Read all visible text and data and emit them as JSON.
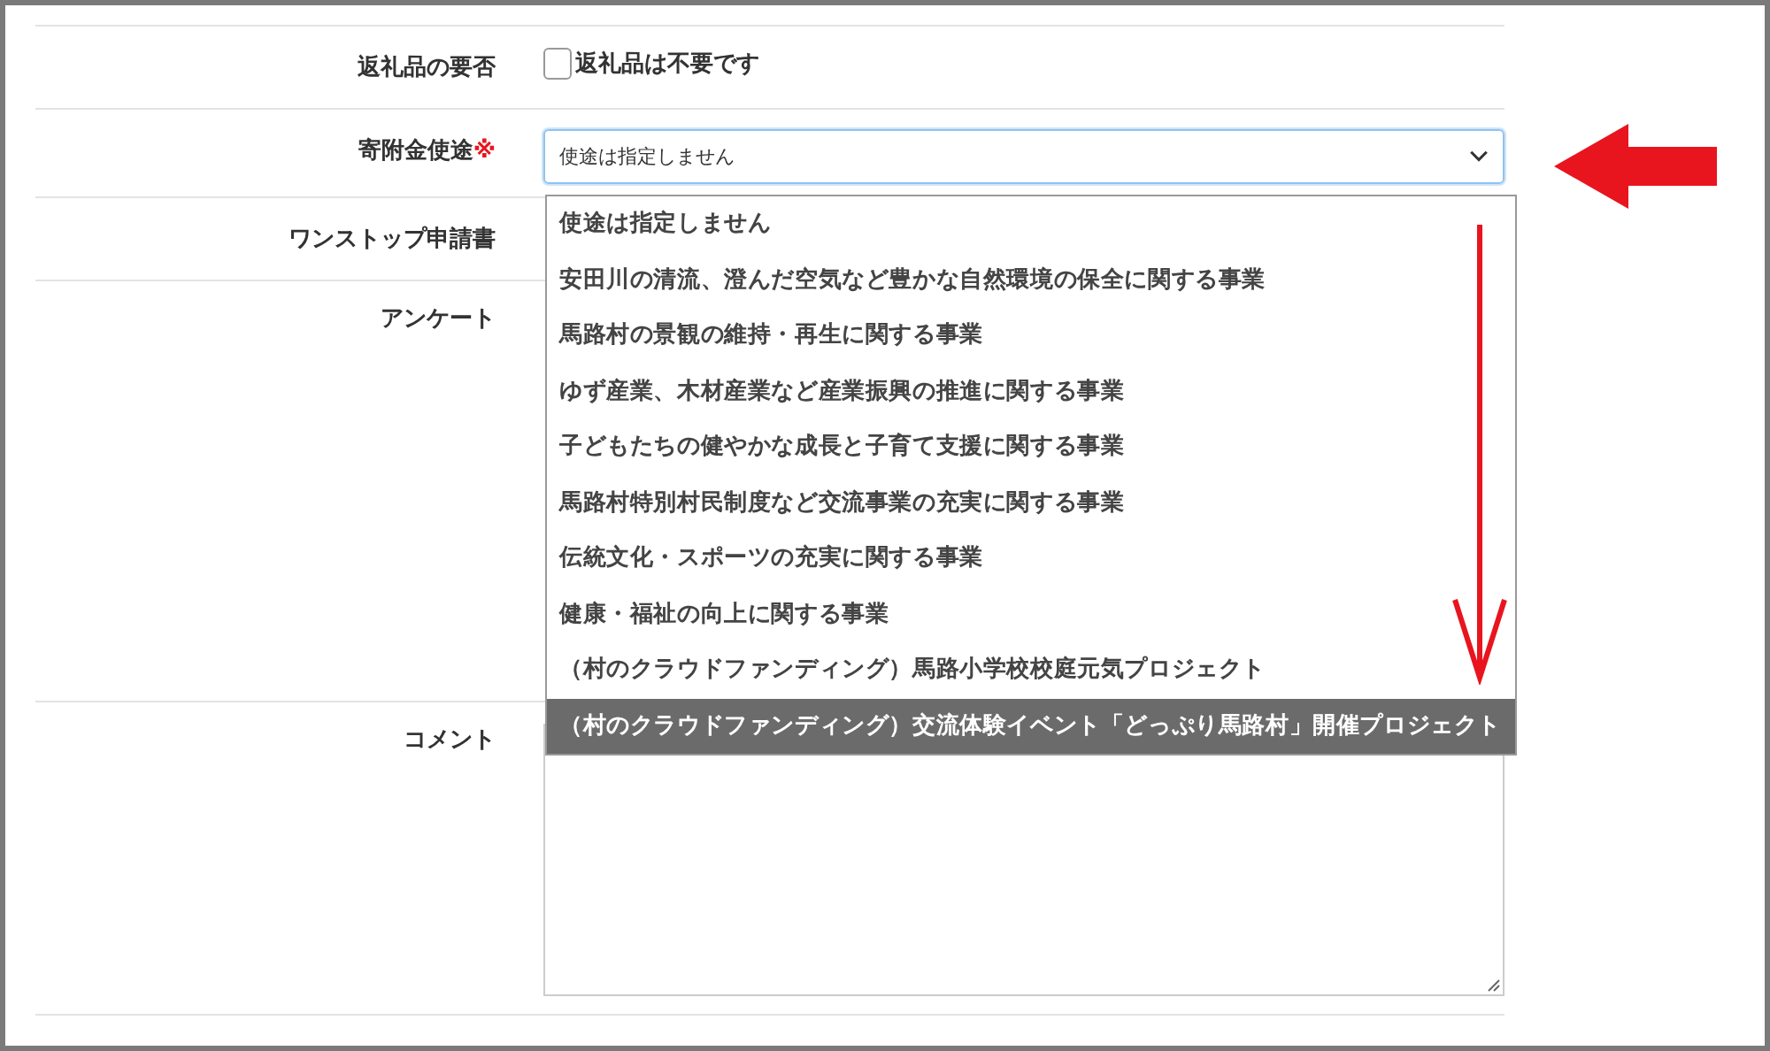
{
  "rows": [
    {
      "kind": "checkbox",
      "label": "返礼品の要否",
      "option": {
        "label": "返礼品は不要です",
        "checked": false
      }
    },
    {
      "kind": "select",
      "label": "寄附金使途",
      "required_mark": "※",
      "value": "使途は指定しません",
      "expanded": true,
      "options": [
        {
          "label": "使途は指定しません",
          "highlighted": false
        },
        {
          "label": "安田川の清流、澄んだ空気など豊かな自然環境の保全に関する事業",
          "highlighted": false
        },
        {
          "label": "馬路村の景観の維持・再生に関する事業",
          "highlighted": false
        },
        {
          "label": "ゆず産業、木材産業など産業振興の推進に関する事業",
          "highlighted": false
        },
        {
          "label": "子どもたちの健やかな成長と子育て支援に関する事業",
          "highlighted": false
        },
        {
          "label": "馬路村特別村民制度など交流事業の充実に関する事業",
          "highlighted": false
        },
        {
          "label": "伝統文化・スポーツの充実に関する事業",
          "highlighted": false
        },
        {
          "label": "健康・福祉の向上に関する事業",
          "highlighted": false
        },
        {
          "label": "（村のクラウドファンディング）馬路小学校校庭元気プロジェクト",
          "highlighted": false
        },
        {
          "label": "（村のクラウドファンディング）交流体験イベント「どっぷり馬路村」開催プロジェクト",
          "highlighted": true
        }
      ]
    },
    {
      "kind": "covered",
      "label": "ワンストップ申請書"
    },
    {
      "kind": "covered",
      "label": "アンケート"
    },
    {
      "kind": "textarea",
      "label": "コメント"
    }
  ]
}
